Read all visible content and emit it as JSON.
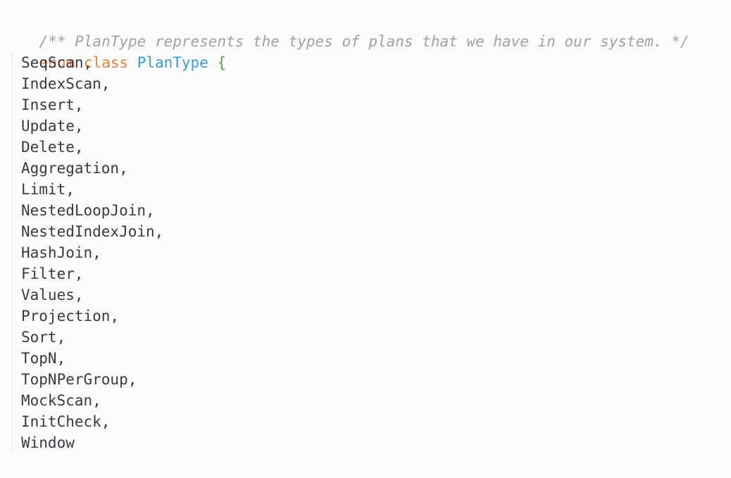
{
  "editor": {
    "comment": "/** PlanType represents the types of plans that we have in our system. */",
    "keyword_enum": "enum",
    "keyword_class": "class",
    "type_name": "PlanType",
    "open_brace": "{",
    "close_brace": "}",
    "close_semicolon": ";",
    "members": [
      {
        "name": "SeqScan",
        "sep": ","
      },
      {
        "name": "IndexScan",
        "sep": ","
      },
      {
        "name": "Insert",
        "sep": ","
      },
      {
        "name": "Update",
        "sep": ","
      },
      {
        "name": "Delete",
        "sep": ","
      },
      {
        "name": "Aggregation",
        "sep": ","
      },
      {
        "name": "Limit",
        "sep": ","
      },
      {
        "name": "NestedLoopJoin",
        "sep": ","
      },
      {
        "name": "NestedIndexJoin",
        "sep": ","
      },
      {
        "name": "HashJoin",
        "sep": ","
      },
      {
        "name": "Filter",
        "sep": ","
      },
      {
        "name": "Values",
        "sep": ","
      },
      {
        "name": "Projection",
        "sep": ","
      },
      {
        "name": "Sort",
        "sep": ","
      },
      {
        "name": "TopN",
        "sep": ","
      },
      {
        "name": "TopNPerGroup",
        "sep": ","
      },
      {
        "name": "MockScan",
        "sep": ","
      },
      {
        "name": "InitCheck",
        "sep": ","
      },
      {
        "name": "Window",
        "sep": ""
      }
    ],
    "colors": {
      "background": "#fbfbfb",
      "comment": "#a0a1a7",
      "keyword": "#f07f3a",
      "type": "#3d9ad9",
      "brace": "#50a14f",
      "text": "#383a42"
    }
  }
}
